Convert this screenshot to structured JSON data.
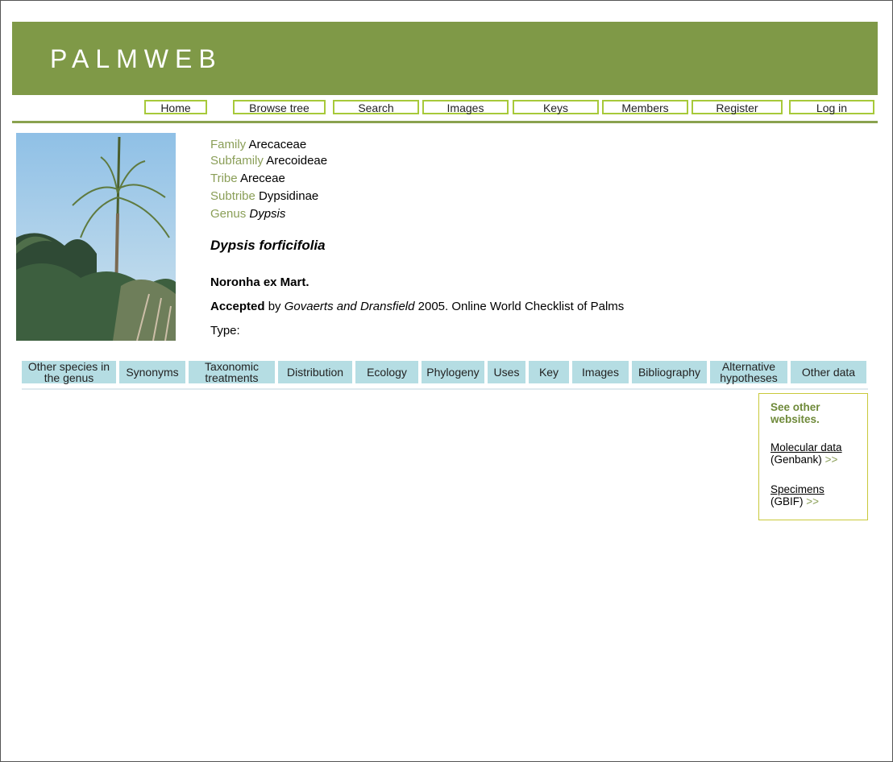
{
  "site": {
    "logo": "PALMWEB"
  },
  "nav": {
    "items": [
      {
        "label": "Home"
      },
      {
        "label": "Browse tree"
      },
      {
        "label": "Search"
      },
      {
        "label": "Images"
      },
      {
        "label": "Keys"
      },
      {
        "label": "Members"
      },
      {
        "label": "Register"
      },
      {
        "label": "Log in"
      }
    ]
  },
  "taxonomy": [
    {
      "label": "Family",
      "value": "Arecaceae"
    },
    {
      "label": "Subfamily",
      "value": "Arecoideae"
    },
    {
      "label": "Tribe",
      "value": "Areceae"
    },
    {
      "label": "Subtribe",
      "value": "Dypsidinae"
    },
    {
      "label": "Genus",
      "value": "Dypsis"
    }
  ],
  "species": {
    "name": "Dypsis forficifolia",
    "author": "Noronha ex Mart.",
    "accepted_label": "Accepted",
    "accepted_by": "by",
    "accepted_source": "Govaerts and Dransfield",
    "accepted_rest": "2005. Online World Checklist of Palms",
    "type_label": "Type:"
  },
  "tabs": [
    {
      "line1": "Other species in",
      "line2": "the genus"
    },
    {
      "line1": "Synonyms",
      "line2": ""
    },
    {
      "line1": "Taxonomic",
      "line2": "treatments"
    },
    {
      "line1": "Distribution",
      "line2": ""
    },
    {
      "line1": "Ecology",
      "line2": ""
    },
    {
      "line1": "Phylogeny",
      "line2": ""
    },
    {
      "line1": "Uses",
      "line2": ""
    },
    {
      "line1": "Key",
      "line2": ""
    },
    {
      "line1": "Images",
      "line2": ""
    },
    {
      "line1": "Bibliography",
      "line2": ""
    },
    {
      "line1": "Alternative",
      "line2": "hypotheses"
    },
    {
      "line1": "Other data",
      "line2": ""
    }
  ],
  "sidebar": {
    "heading_line1": "See other",
    "heading_line2": "websites",
    "heading_dot": ".",
    "links": [
      {
        "label": "Molecular data",
        "sub": "(Genbank)",
        "arrow": ">>"
      },
      {
        "label": "Specimens",
        "sub": "(GBIF)",
        "arrow": ">>"
      }
    ]
  },
  "colors": {
    "banner": "#7f9947",
    "nav_border": "#a7c93a",
    "tab_bg": "#b5dde3",
    "taxon_label": "#8a9e57"
  }
}
